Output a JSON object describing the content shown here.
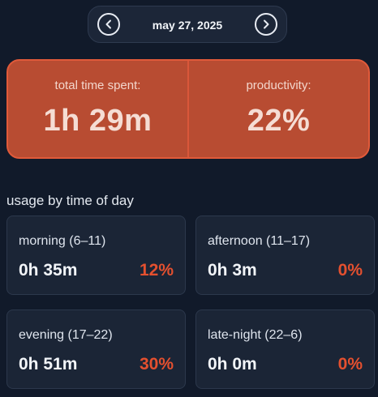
{
  "date_nav": {
    "date": "may 27, 2025",
    "prev_icon": "chevron-left-icon",
    "next_icon": "chevron-right-icon"
  },
  "summary": {
    "time_label": "total time spent:",
    "time_value": "1h 29m",
    "productivity_label": "productivity:",
    "productivity_value": "22%"
  },
  "usage": {
    "title": "usage by time of day",
    "periods": [
      {
        "name": "morning (6–11)",
        "time": "0h 35m",
        "percent": "12%"
      },
      {
        "name": "afternoon (11–17)",
        "time": "0h 3m",
        "percent": "0%"
      },
      {
        "name": "evening (17–22)",
        "time": "0h 51m",
        "percent": "30%"
      },
      {
        "name": "late-night (22–6)",
        "time": "0h 0m",
        "percent": "0%"
      }
    ]
  },
  "colors": {
    "background": "#111a2a",
    "summary_card": "#b84c32",
    "accent_percent": "#e4502f",
    "card": "#1b2536"
  }
}
